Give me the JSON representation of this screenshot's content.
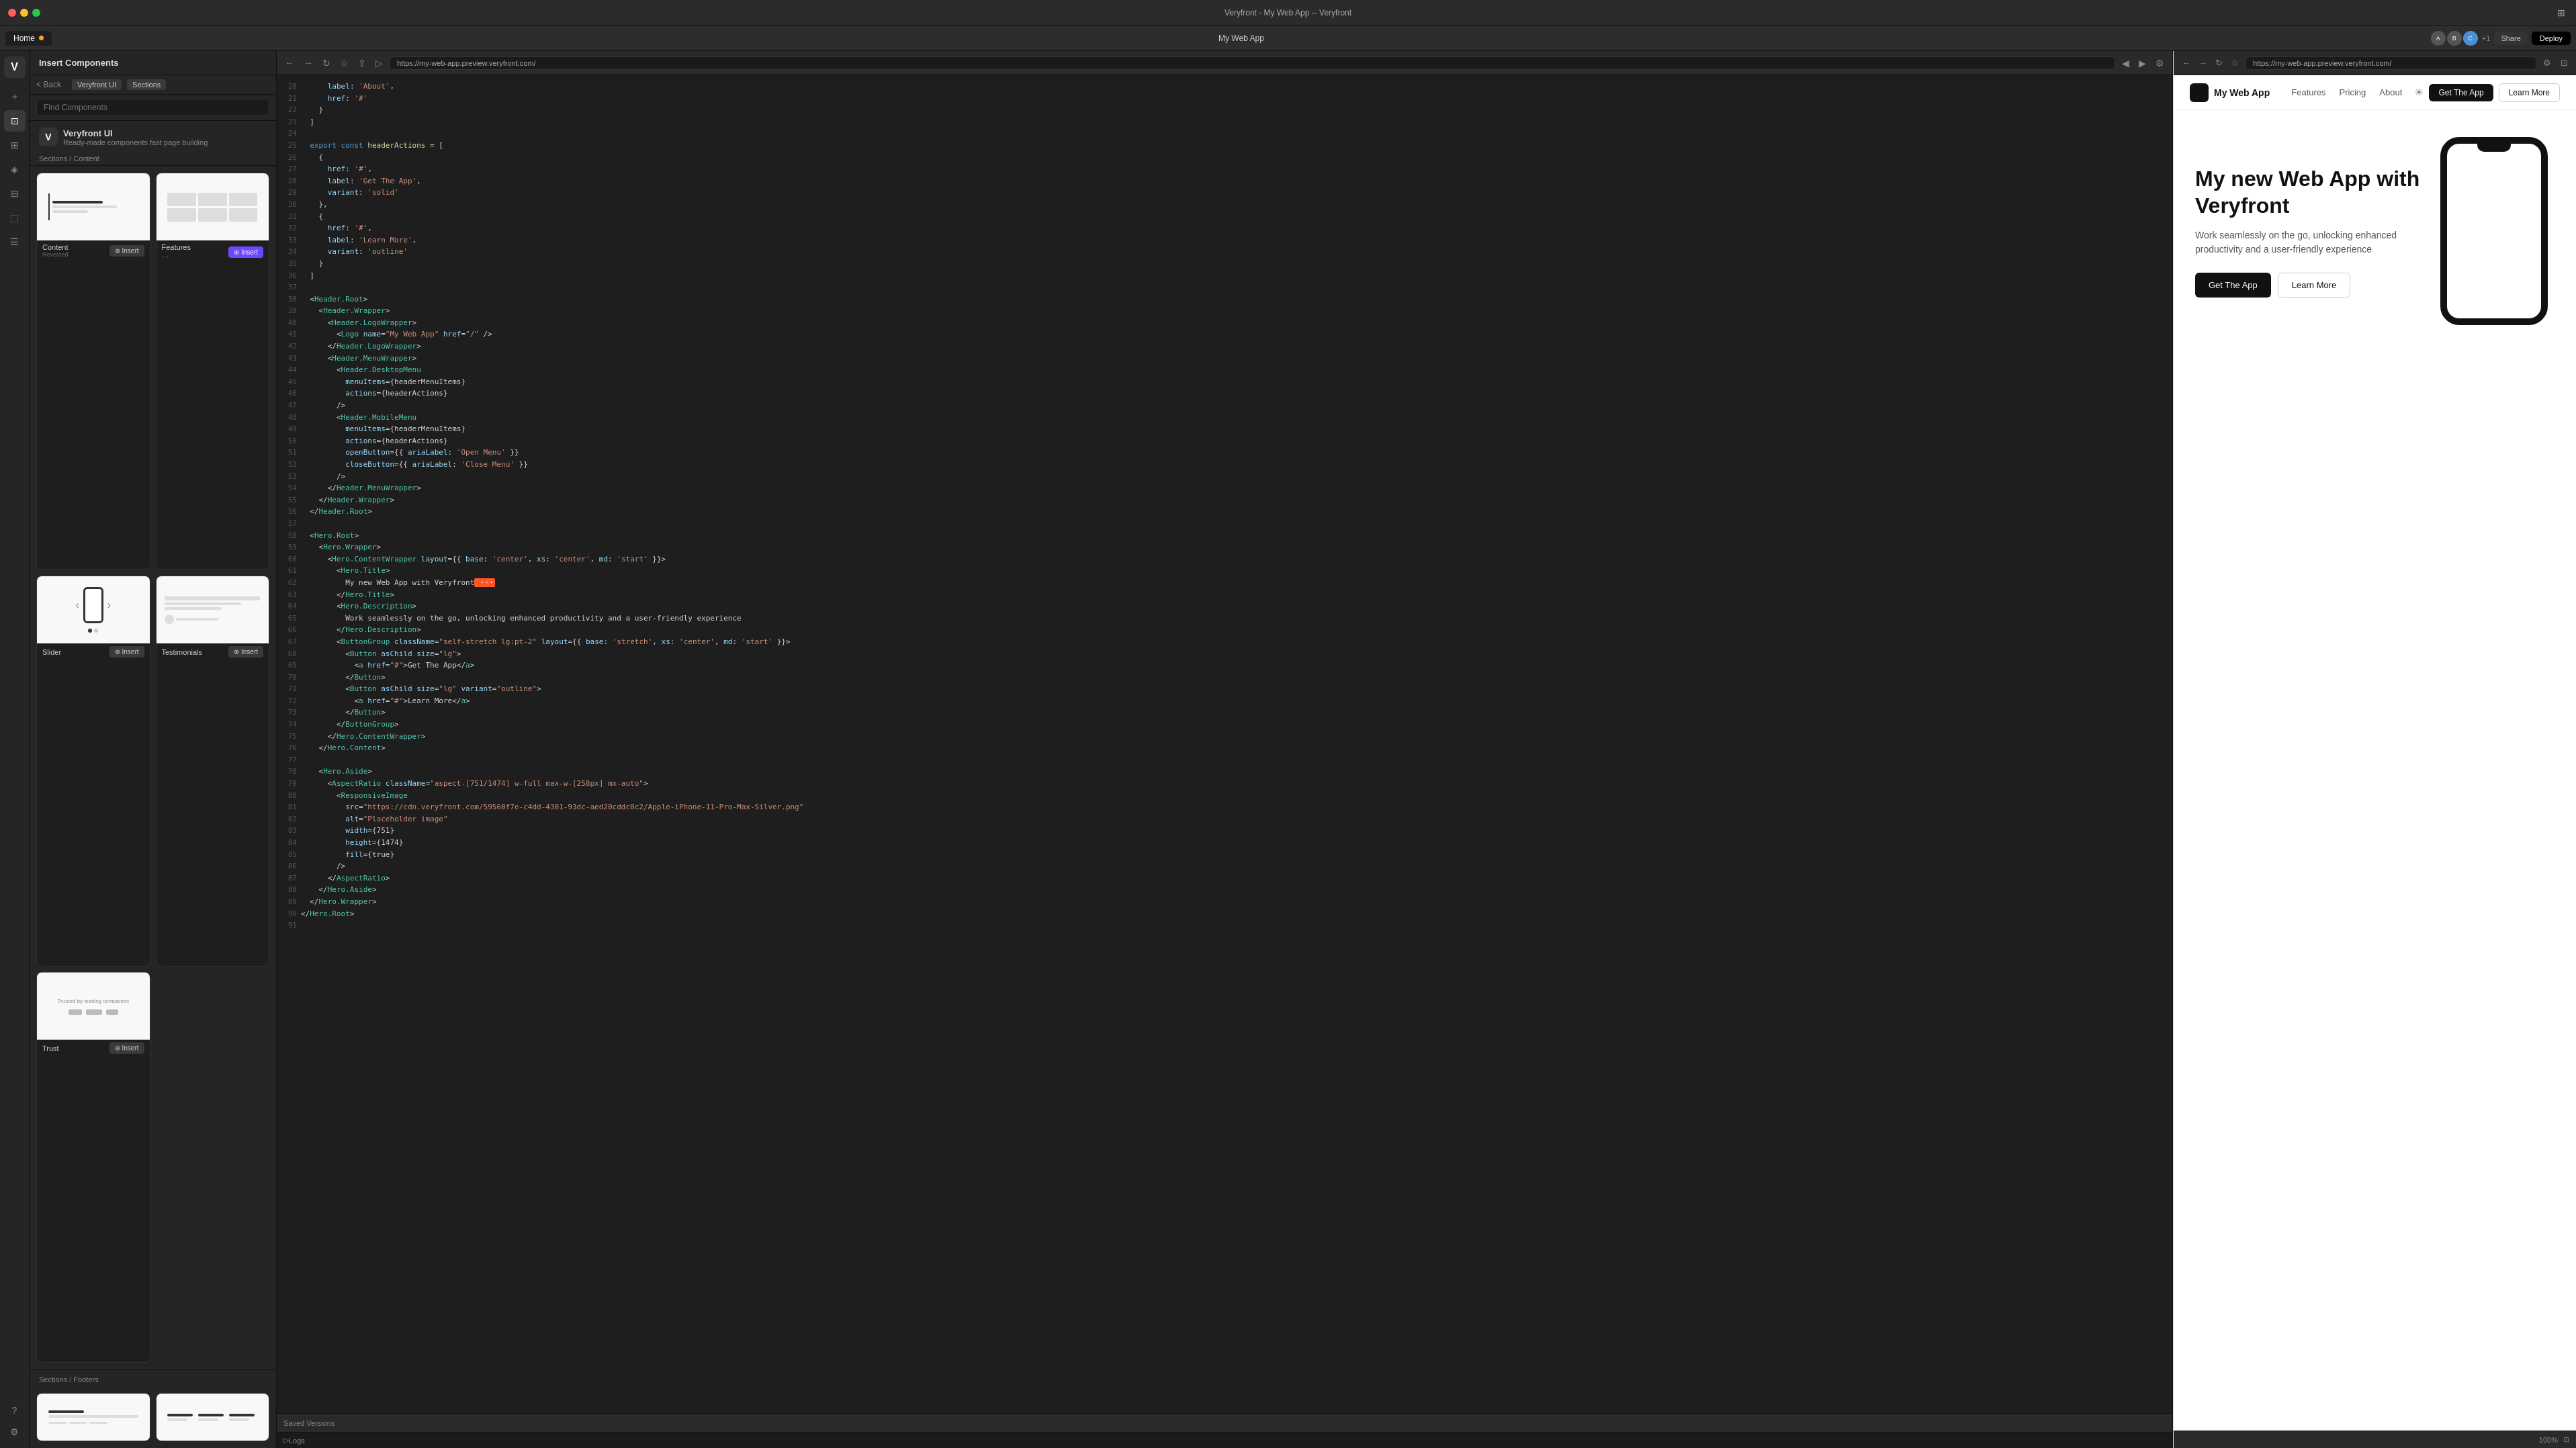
{
  "window": {
    "title": "Veryfront - My Web App -- Veryfront",
    "tab_label": "My Web App",
    "tab_url": "https://my-web-app.preview.veryfront.com/"
  },
  "titlebar": {
    "app_name": "My Web App",
    "fullscreen_icon": "⊞",
    "share_label": "Share",
    "deploy_label": "Deploy"
  },
  "sidebar": {
    "brand_letter": "V",
    "items": [
      {
        "icon": "＋",
        "name": "add-icon"
      },
      {
        "icon": "⊡",
        "name": "components-icon"
      },
      {
        "icon": "⊞",
        "name": "layout-icon"
      },
      {
        "icon": "⧫",
        "name": "shapes-icon"
      },
      {
        "icon": "⊟",
        "name": "layers-icon"
      },
      {
        "icon": "⬚",
        "name": "assets-icon"
      },
      {
        "icon": "⊞",
        "name": "pages-icon"
      },
      {
        "icon": "☰",
        "name": "more-icon"
      }
    ],
    "bottom_items": [
      {
        "icon": "?",
        "name": "help-icon"
      },
      {
        "icon": "⚙",
        "name": "settings-icon"
      }
    ]
  },
  "components_panel": {
    "header": "Insert Components",
    "back_label": "< Back",
    "library_badge": "Veryfront UI",
    "sections_badge": "Sections",
    "search_placeholder": "Find Components",
    "library_letter": "V",
    "library_name": "Veryfront UI",
    "library_desc": "Ready-made components fast page building",
    "sections_content_label": "Sections / Content",
    "sections_footers_label": "Sections / Footers",
    "cards": [
      {
        "label": "Content",
        "sublabel": "Reversed",
        "insert": "Insert",
        "primary": false
      },
      {
        "label": "Features",
        "sublabel": "",
        "insert": "Insert",
        "primary": true
      },
      {
        "label": "Slider",
        "sublabel": "",
        "insert": "Insert",
        "primary": false
      },
      {
        "label": "Testimonials",
        "sublabel": "",
        "insert": "Insert",
        "primary": false
      },
      {
        "label": "Trust",
        "sublabel": "",
        "insert": "Insert",
        "primary": false
      }
    ]
  },
  "editor": {
    "tab_label": "Home",
    "url": "https://my-web-app.preview.veryfront.com/",
    "saved_versions_label": "Saved Versions",
    "logs_label": "Logs",
    "lines": [
      "      label: 'About',",
      "      href: '#'",
      "    }",
      "  ]",
      "",
      "  export const headerActions = [",
      "    {",
      "      href: '#',",
      "      label: 'Get The App',",
      "      variant: 'solid'",
      "    },",
      "    {",
      "      href: '#',",
      "      label: 'Learn More',",
      "      variant: 'outline'",
      "    }",
      "  ]",
      "",
      "  <Header.Root>",
      "    <Header.Wrapper>",
      "      <Header.LogoWrapper>",
      "        <Logo name=\"My Web App\" href=\"/\" />",
      "      </Header.LogoWrapper>",
      "      <Header.MenuWrapper>",
      "        <Header.DesktopMenu",
      "          menuItems={headerMenuItems}",
      "          actions={headerActions}",
      "        />",
      "        <Header.MobileMenu",
      "          menuItems={headerMenuItems}",
      "          actions={headerActions}",
      "          openButton={{ ariaLabel: 'Open Menu' }}",
      "          closeButton={{ ariaLabel: 'Close Menu' }}",
      "        />",
      "      </Header.MenuWrapper>",
      "    </Header.Wrapper>",
      "  </Header.Root>",
      "",
      "  <Hero.Root>",
      "    <Hero.Wrapper>",
      "      <Hero.ContentWrapper layout={{ base: 'center', xs: 'center', md: 'start' }}>",
      "        <Hero.Title>",
      "          My new Web App with Veryfront",
      "        </Hero.Title>",
      "        <Hero.Description>",
      "          Work seamlessly on the go, unlocking enhanced productivity and a user-friendly experience",
      "        </Hero.Description>",
      "        <ButtonGroup className=\"self-stretch lg:pt-2\" layout={{ base: 'stretch', xs: 'center', md: 'start' }}>",
      "          <Button asChild size=\"lg\">",
      "            <a href=\"#\">Get The App</a>",
      "          </Button>",
      "          <Button asChild size=\"lg\" variant=\"outline\">",
      "            <a href=\"#\">Learn More</a>",
      "          </Button>",
      "        </ButtonGroup>",
      "      </Hero.ContentWrapper>",
      "    </Hero.Content>",
      "",
      "    <Hero.Aside>",
      "      <AspectRatio className=\"aspect-[751/1474] w-full max-w-[258px] mx-auto\">",
      "        <ResponsiveImage",
      "          src=\"https://cdn.veryfront.com/59560f7e-c4dd-4301-93dc-aed20cddc8c2/Apple-iPhone-11-Pro-Max-Silver.png\"",
      "          alt=\"Placeholder image\"",
      "          width={751}",
      "          height={1474}",
      "          fill={true}",
      "        />",
      "      </AspectRatio>",
      "    </Hero.Aside>",
      "  </Hero.Wrapper>",
      "</Hero.Root>"
    ],
    "line_start": 20
  },
  "preview": {
    "app_name": "My Web App",
    "nav_items": [
      "Features",
      "Pricing",
      "About"
    ],
    "get_app_label": "Get The App",
    "learn_more_label": "Learn More",
    "hero_title": "My new Web App with Veryfront",
    "hero_desc": "Work seamlessly on the go, unlocking enhanced productivity and a user-friendly experience",
    "hero_get_label": "Get The App",
    "hero_learn_label": "Learn More"
  }
}
